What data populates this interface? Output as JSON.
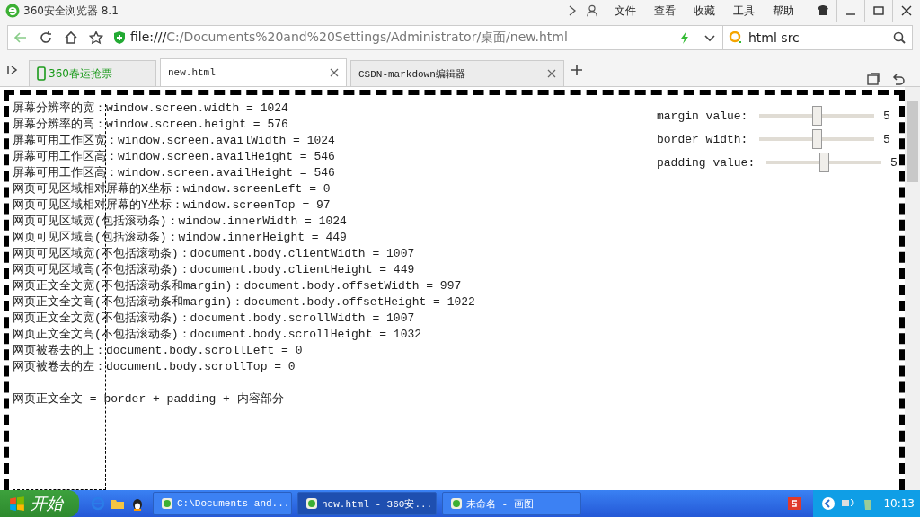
{
  "window": {
    "title": "360安全浏览器 8.1",
    "menu": [
      "文件",
      "查看",
      "收藏",
      "工具",
      "帮助"
    ]
  },
  "address_bar": {
    "url_prefix": "file:///",
    "url": "C:/Documents%20and%20Settings/Administrator/桌面/new.html",
    "search_value": "html src"
  },
  "tabs": [
    {
      "label": "360春运抢票",
      "selected": false,
      "kind": "promo",
      "closable": false
    },
    {
      "label": "new.html",
      "selected": true,
      "kind": "page",
      "closable": true
    },
    {
      "label": "CSDN-markdown编辑器",
      "selected": false,
      "kind": "page",
      "closable": true
    }
  ],
  "content": {
    "lines": [
      "屏幕分辨率的宽：window.screen.width = 1024",
      "屏幕分辨率的高：window.screen.height = 576",
      "屏幕可用工作区宽：window.screen.availWidth = 1024",
      "屏幕可用工作区高：window.screen.availHeight = 546",
      "屏幕可用工作区高：window.screen.availHeight = 546",
      "网页可见区域相对屏幕的X坐标：window.screenLeft = 0",
      "网页可见区域相对屏幕的Y坐标：window.screenTop = 97",
      "网页可见区域宽(包括滚动条)：window.innerWidth = 1024",
      "网页可见区域高(包括滚动条)：window.innerHeight = 449",
      "网页可见区域宽(不包括滚动条)：document.body.clientWidth = 1007",
      "网页可见区域高(不包括滚动条)：document.body.clientHeight = 449",
      "网页正文全文宽(不包括滚动条和margin)：document.body.offsetWidth = 997",
      "网页正文全文高(不包括滚动条和margin)：document.body.offsetHeight = 1022",
      "网页正文全文宽(不包括滚动条)：document.body.scrollWidth = 1007",
      "网页正文全文高(不包括滚动条)：document.body.scrollHeight = 1032",
      "网页被卷去的上：document.body.scrollLeft = 0",
      "网页被卷去的左：document.body.scrollTop = 0"
    ],
    "formula": "网页正文全文 = border + padding + 内容部分",
    "sliders": [
      {
        "label": "margin value:",
        "level": 0.5,
        "reading": "5"
      },
      {
        "label": "border width:",
        "level": 0.5,
        "reading": "5"
      },
      {
        "label": "padding value:",
        "level": 0.5,
        "reading": "5"
      }
    ]
  },
  "taskbar": {
    "start": "开始",
    "tasks": [
      {
        "label": "C:\\Documents and...",
        "selected": false
      },
      {
        "label": "new.html - 360安...",
        "selected": true
      },
      {
        "label": "未命名 - 画图",
        "selected": false
      }
    ],
    "clock": "10:13"
  }
}
